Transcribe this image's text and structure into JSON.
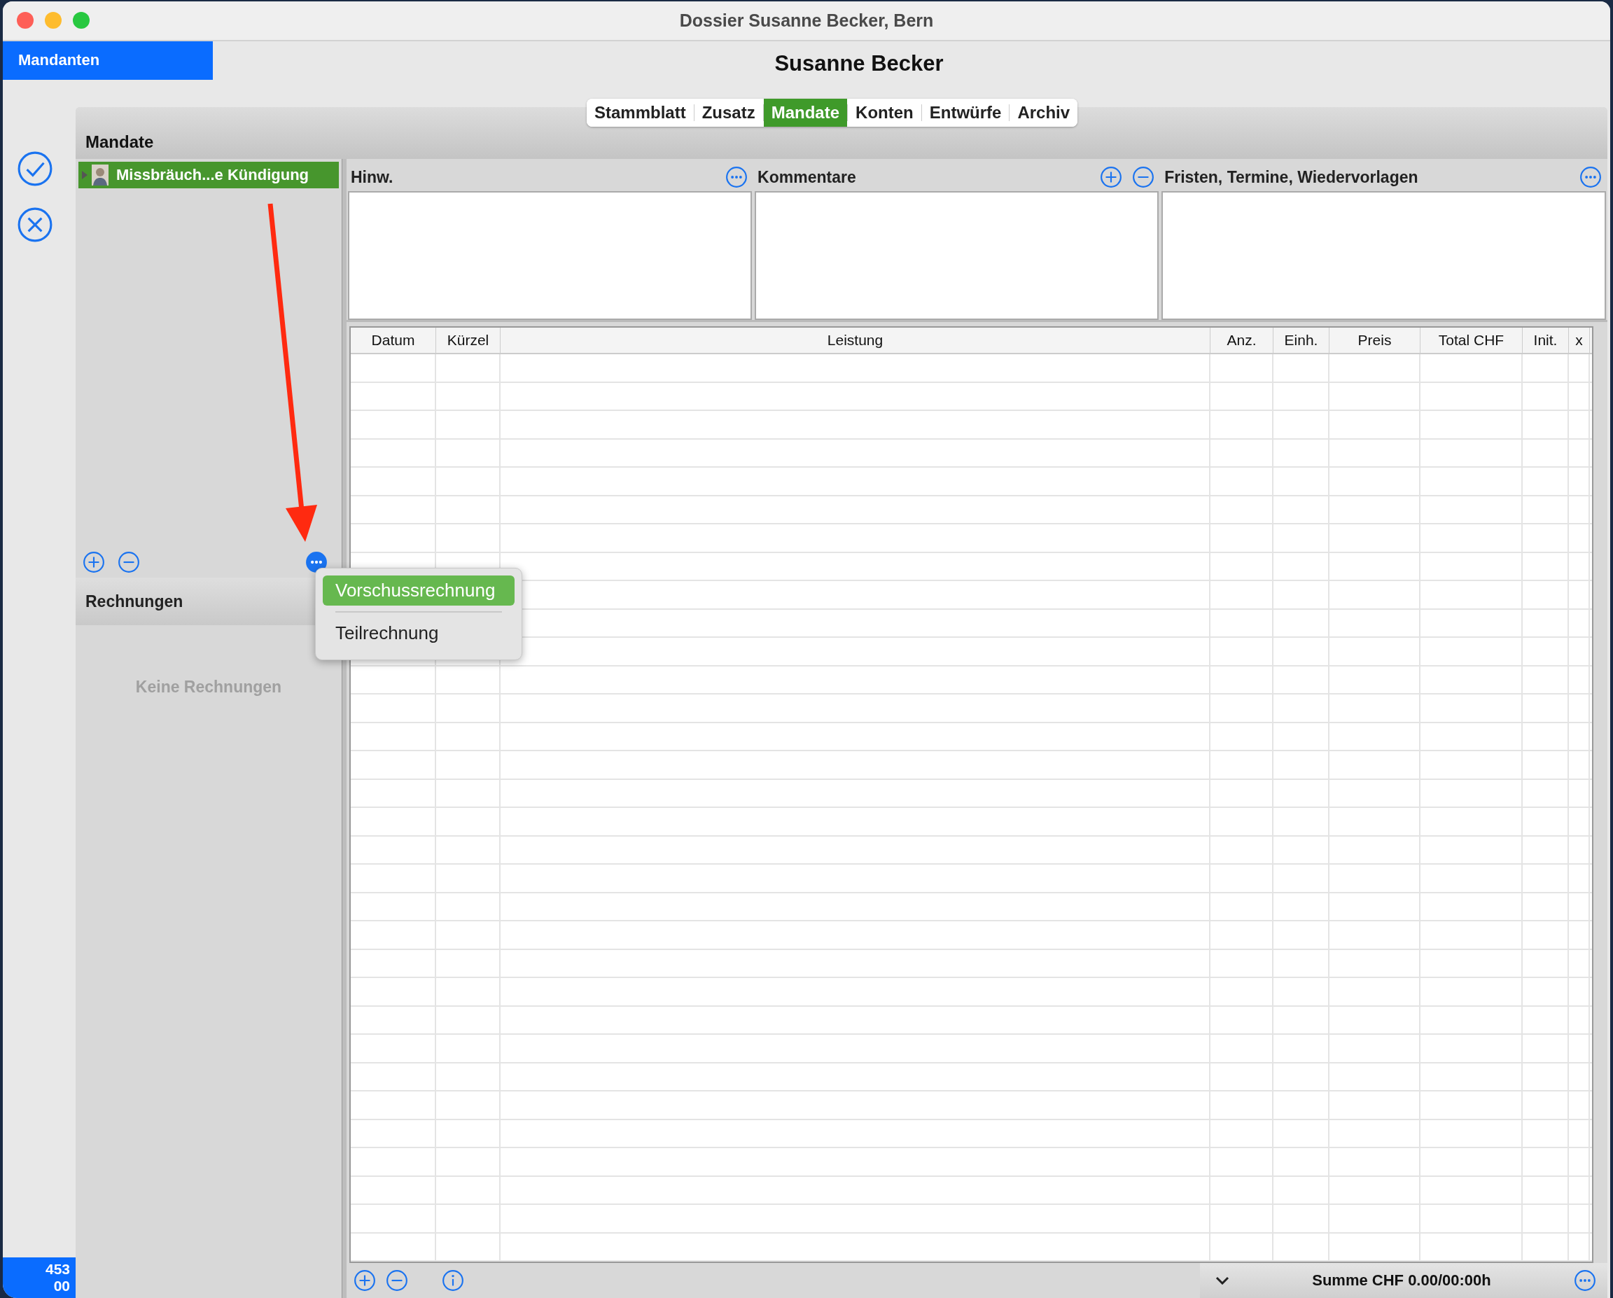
{
  "window": {
    "title": "Dossier Susanne Becker, Bern"
  },
  "mandanten_button": {
    "label": "Mandanten"
  },
  "badge": {
    "lines": [
      "453",
      "00"
    ]
  },
  "client_name": "Susanne Becker",
  "tabs": [
    {
      "label": "Stammblatt",
      "selected": false
    },
    {
      "label": "Zusatz",
      "selected": false
    },
    {
      "label": "Mandate",
      "selected": true
    },
    {
      "label": "Konten",
      "selected": false
    },
    {
      "label": "Entwürfe",
      "selected": false
    },
    {
      "label": "Archiv",
      "selected": false
    }
  ],
  "mandate_section": {
    "title": "Mandate",
    "items": [
      {
        "label": "Missbräuch...e Kündigung",
        "selected": true
      }
    ]
  },
  "panels": [
    {
      "title": "Hinw."
    },
    {
      "title": "Kommentare"
    },
    {
      "title": "Fristen, Termine, Wiedervorlagen"
    }
  ],
  "table": {
    "columns": [
      "Datum",
      "Kürzel",
      "Leistung",
      "Anz.",
      "Einh.",
      "Preis",
      "Total CHF",
      "Init.",
      "x"
    ]
  },
  "rechnungen": {
    "title": "Rechnungen",
    "empty_text": "Keine Rechnungen"
  },
  "menu": {
    "items": [
      {
        "label": "Vorschussrechnung",
        "selected": true
      },
      {
        "label": "Teilrechnung",
        "selected": false
      }
    ]
  },
  "summary": "Summe CHF 0.00/00:00h"
}
